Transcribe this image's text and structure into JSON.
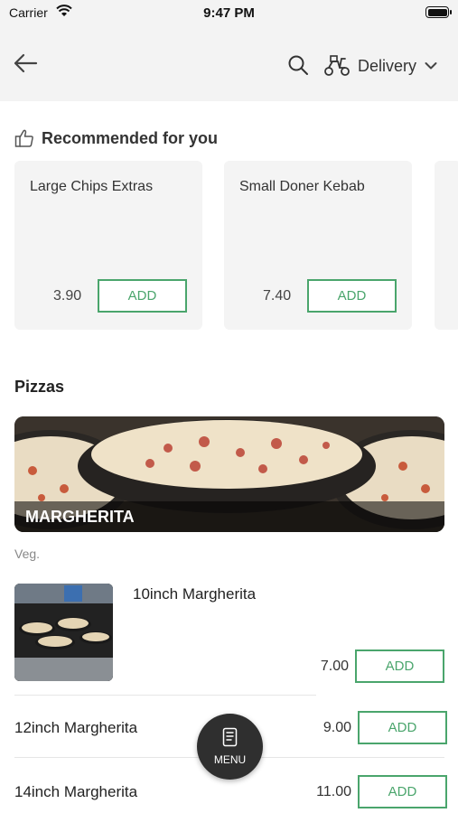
{
  "status_bar": {
    "carrier": "Carrier",
    "time": "9:47 PM"
  },
  "header": {
    "back_icon": "back-arrow-icon",
    "search_icon": "search-icon",
    "delivery_icon": "scooter-icon",
    "delivery_label": "Delivery",
    "chevron_icon": "chevron-down-icon"
  },
  "recommended": {
    "title": "Recommended for you",
    "icon": "thumbs-up-icon",
    "items": [
      {
        "name": "Large Chips Extras",
        "price": "3.90",
        "button": "ADD"
      },
      {
        "name": "Small Doner Kebab",
        "price": "7.40",
        "button": "ADD"
      }
    ]
  },
  "section": {
    "title": "Pizzas",
    "banner_label": "MARGHERITA",
    "tag": "Veg.",
    "items": [
      {
        "name": "10inch Margherita",
        "price": "7.00",
        "button": "ADD"
      },
      {
        "name": "12inch Margherita",
        "price": "9.00",
        "button": "ADD"
      },
      {
        "name": "14inch Margherita",
        "price": "11.00",
        "button": "ADD"
      }
    ]
  },
  "fab": {
    "label": "MENU",
    "icon": "menu-book-icon"
  },
  "colors": {
    "accent": "#4aa56c",
    "header_bg": "#f3f3f3",
    "card_bg": "#f4f4f4",
    "fab_bg": "#2f2f2f"
  }
}
